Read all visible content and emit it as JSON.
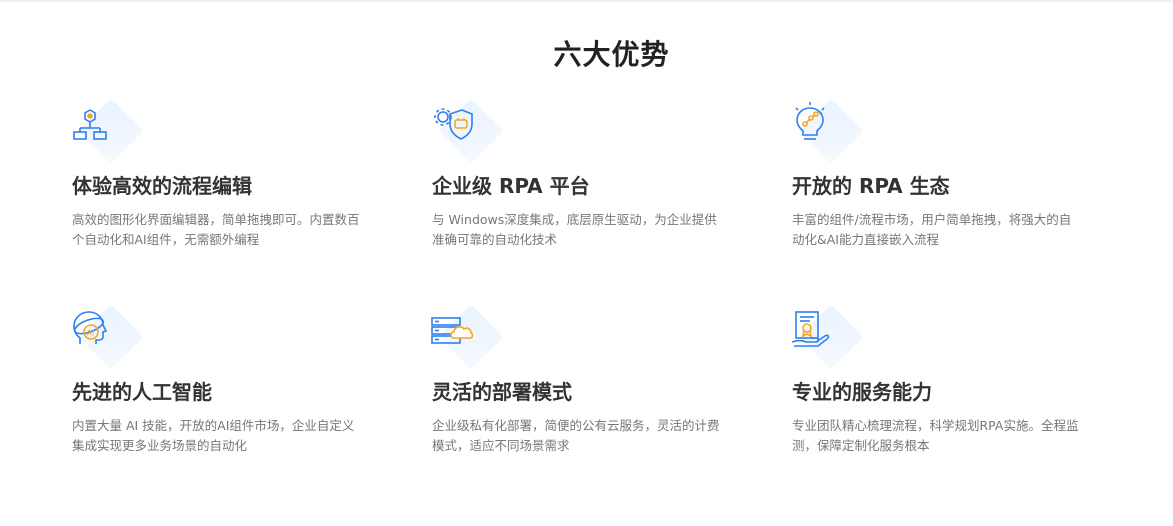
{
  "title": "六大优势",
  "features": [
    {
      "icon": "flowchart-icon",
      "title": "体验高效的流程编辑",
      "desc": "高效的图形化界面编辑器，简单拖拽即可。内置数百个自动化和AI组件，无需额外编程"
    },
    {
      "icon": "shield-gear-icon",
      "title": "企业级 RPA 平台",
      "desc": "与 Windows深度集成，底层原生驱动，为企业提供准确可靠的自动化技术"
    },
    {
      "icon": "lightbulb-network-icon",
      "title": "开放的 RPA 生态",
      "desc": "丰富的组件/流程市场，用户简单拖拽，将强大的自动化&AI能力直接嵌入流程"
    },
    {
      "icon": "ai-head-icon",
      "title": "先进的人工智能",
      "desc": "内置大量 AI 技能，开放的AI组件市场，企业自定义集成实现更多业务场景的自动化"
    },
    {
      "icon": "server-cloud-icon",
      "title": "灵活的部署模式",
      "desc": "企业级私有化部署，简便的公有云服务，灵活的计费模式，适应不同场景需求"
    },
    {
      "icon": "certificate-hand-icon",
      "title": "专业的服务能力",
      "desc": "专业团队精心梳理流程，科学规划RPA实施。全程监测，保障定制化服务根本"
    }
  ],
  "colors": {
    "icon_blue": "#2f80ed",
    "icon_orange": "#f5a623",
    "diamond_bg": "#eaf3fe"
  }
}
